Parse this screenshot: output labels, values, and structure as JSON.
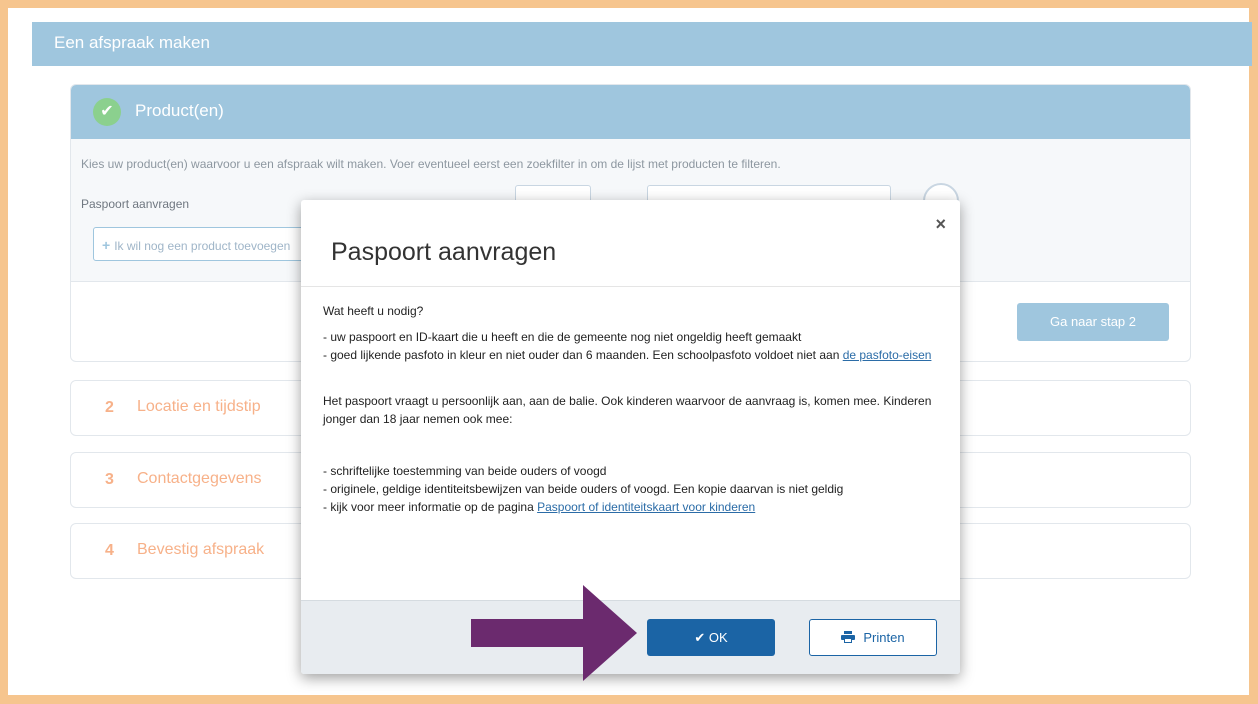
{
  "header": {
    "title": "Een afspraak maken"
  },
  "step1": {
    "title": "Product(en)",
    "intro": "Kies uw product(en) waarvoor u een afspraak wilt maken. Voer eventueel eerst een zoekfilter in om de lijst met producten te filteren.",
    "product_label": "Paspoort aanvragen",
    "add_button": "Ik wil nog een product toevoegen",
    "next_button": "Ga naar stap 2"
  },
  "steps": [
    {
      "number": "2",
      "label": "Locatie en tijdstip"
    },
    {
      "number": "3",
      "label": "Contactgegevens"
    },
    {
      "number": "4",
      "label": "Bevestig afspraak"
    }
  ],
  "modal": {
    "title": "Paspoort aanvragen",
    "close": "×",
    "question": "Wat heeft u nodig?",
    "req1": "- uw paspoort en ID-kaart die u heeft en die de gemeente nog niet ongeldig heeft gemaakt",
    "req2": "- goed lijkende pasfoto in kleur en niet ouder dan 6 maanden. Een schoolpasfoto voldoet niet aan ",
    "req2_link": "de pasfoto-eisen",
    "para2": "Het paspoort vraagt u persoonlijk aan, aan de balie. Ook kinderen waarvoor de aanvraag is, komen mee. Kinderen jonger dan 18 jaar nemen ook mee:",
    "kid1": "- schriftelijke toestemming van beide ouders of voogd",
    "kid2": "- originele, geldige identiteitsbewijzen van beide ouders of voogd. Een kopie daarvan is niet geldig",
    "kid3": "- kijk voor meer informatie op de pagina ",
    "kid3_link": "Paspoort of identiteitskaart voor kinderen",
    "ok_button": "OK",
    "print_button": "Printen"
  },
  "colors": {
    "accent": "#9fc6de",
    "primary": "#1b64a5",
    "step_text": "#f7b189",
    "arrow": "#6b2a6e",
    "frame": "#f6c58e"
  }
}
